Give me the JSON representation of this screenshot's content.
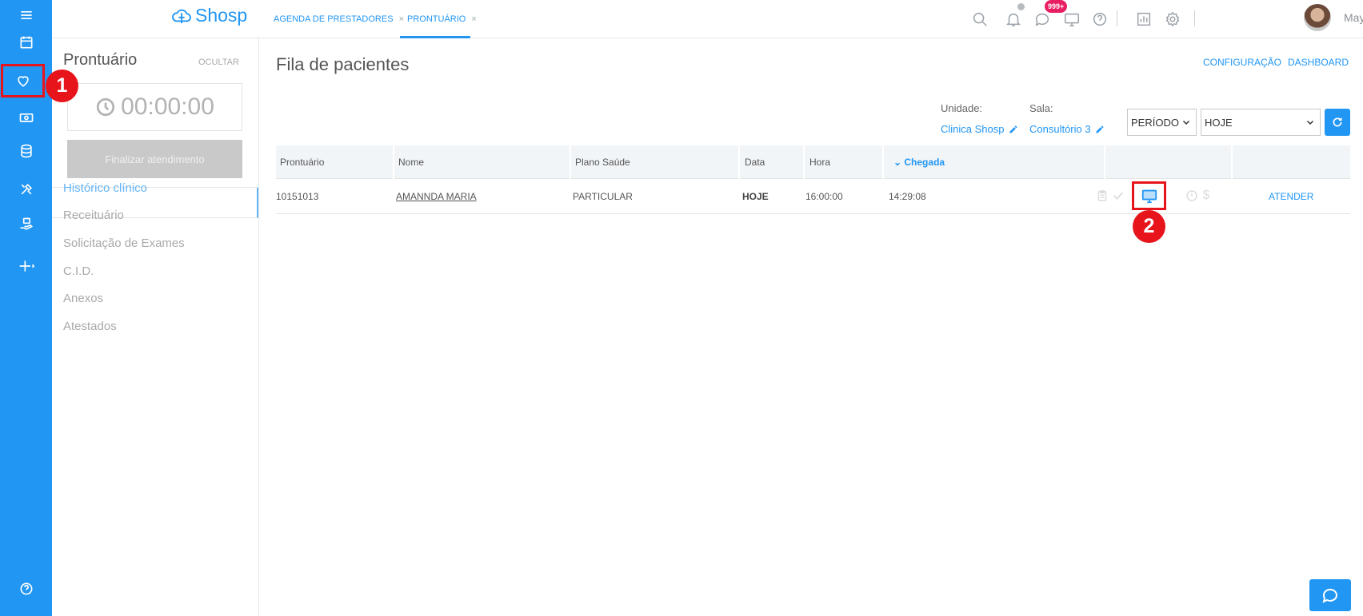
{
  "brand": {
    "name": "Shosp"
  },
  "tabs": [
    {
      "label": "AGENDA DE PRESTADORES",
      "close": "×"
    },
    {
      "label": "PRONTUÁRIO",
      "close": "×"
    }
  ],
  "header": {
    "notification_badge": "999+",
    "user_name": "Maycon"
  },
  "annotations": {
    "marker_1": "1",
    "marker_2": "2"
  },
  "left_panel": {
    "title": "Prontuário",
    "hide_label": "OCULTAR",
    "timer": "00:00:00",
    "finish_button": "Finalizar atendimento",
    "menu": [
      {
        "label": "Histórico clínico",
        "active": true
      },
      {
        "label": "Receituário",
        "active": false
      },
      {
        "label": "Solicitação de Exames",
        "active": false
      },
      {
        "label": "C.I.D.",
        "active": false
      },
      {
        "label": "Anexos",
        "active": false
      },
      {
        "label": "Atestados",
        "active": false
      }
    ]
  },
  "main": {
    "title": "Fila de pacientes",
    "links": {
      "config": "CONFIGURAÇÃO",
      "dashboard": "DASHBOARD"
    },
    "filters": {
      "unit_label": "Unidade:",
      "unit_value": "Clinica Shosp",
      "room_label": "Sala:",
      "room_value": "Consultório 3",
      "period_select": "PERÍODO",
      "day_select": "HOJE"
    },
    "table": {
      "headers": [
        "Prontuário",
        "Nome",
        "Plano Saúde",
        "Data",
        "Hora",
        "Chegada"
      ],
      "sorted_column": "Chegada",
      "rows": [
        {
          "record": "10151013",
          "name": "AMANNDA MARIA",
          "plan": "PARTICULAR",
          "date": "HOJE",
          "time": "16:00:00",
          "arrival": "14:29:08",
          "currency": "$",
          "action": "ATENDER"
        }
      ]
    }
  },
  "colors": {
    "primary": "#2196f3",
    "highlight": "#e8141c",
    "badge": "#e91e63",
    "rail": "#2196f3"
  }
}
